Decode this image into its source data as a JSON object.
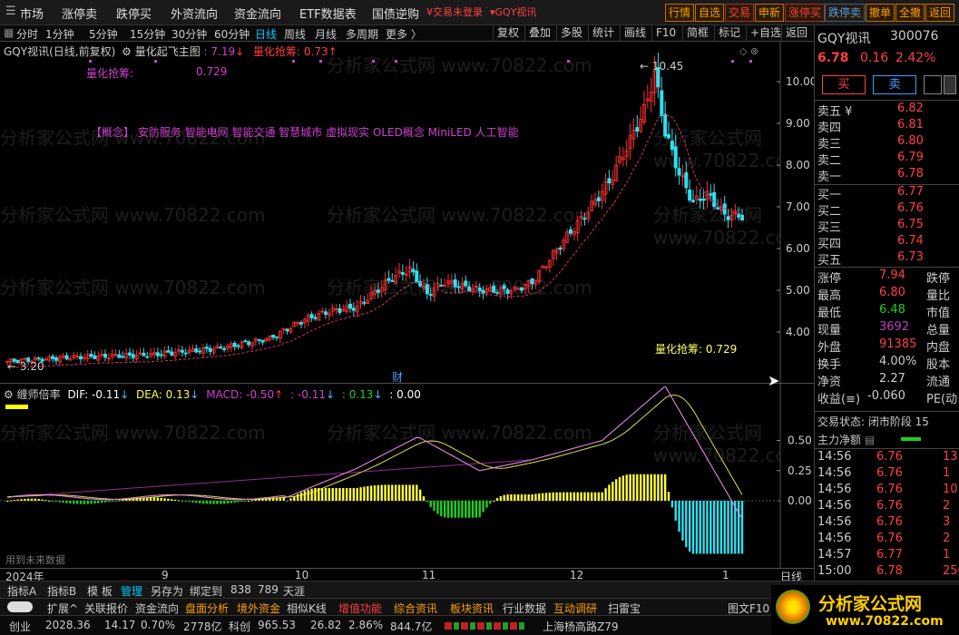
{
  "menu": [
    "市场",
    "涨停卖",
    "跌停买",
    "外资流向",
    "资金流向",
    "ETF数据表",
    "国债逆购"
  ],
  "promo": "¥交易未登录",
  "stock_link": "GQY视讯",
  "top_buttons": [
    "行情",
    "自选",
    "交易",
    "申新",
    "涨停买",
    "跌停卖",
    "撤单",
    "全撤",
    "返回"
  ],
  "periods": [
    "分时",
    "1分钟",
    "5分钟",
    "15分钟",
    "30分钟",
    "60分钟",
    "日线",
    "周线",
    "月线",
    "多周期",
    "更多 〉"
  ],
  "tools": [
    "复权",
    "叠加",
    "多股",
    "统计",
    "画线",
    "F10",
    "简框",
    "标记",
    "+自选",
    "返回"
  ],
  "main_title": {
    "name": "GQY视讯(日线,前复权)",
    "indicator": "量化起飞主图",
    "val1": ": 7.19",
    "label2": "量化抢筹:",
    "val2": "0.73"
  },
  "chip_label": "量化抢筹:",
  "chip_value": "0.729",
  "concept": "【概念】 安防服务 智能电网 智能交通 智慧城市 虚拟现实 OLED概念 MiniLED 人工智能",
  "watermark": "分析家公式网 www.70822.com",
  "yaxis": [
    "10.00",
    "9.00",
    "8.00",
    "7.00",
    "6.00",
    "5.00",
    "4.00"
  ],
  "max_label": "10.45",
  "min_label": "3.20",
  "bottom_label": "量化抢筹:  0.729",
  "cai": "财",
  "macd": {
    "name": "缠师倍率",
    "dif": "DIF: -0.11",
    "dea": "DEA: 0.13",
    "macd": "MACD: -0.50",
    "m1": ": -0.11",
    "m2": ": 0.13",
    "m3": ": 0.00"
  },
  "macd_axis": [
    "0.50",
    "0.25",
    "0.00"
  ],
  "future": "用到未来数据",
  "xaxis": [
    "2024年",
    "9",
    "10",
    "11",
    "12",
    "1"
  ],
  "period_tag": "日线",
  "tabs": [
    "指标A",
    "指标B",
    "模 板",
    "管理",
    "另存为",
    "绑定到",
    "838",
    "789",
    "天涯"
  ],
  "func_tabs": [
    "扩展^",
    "关联报价",
    "资金流向",
    "盘面分析",
    "境外资金",
    "相似K线",
    "增值功能",
    "综合资讯",
    "板块资讯",
    "行业数据",
    "互动调研",
    "扫雷宝"
  ],
  "tuwen": "图文F10",
  "status": {
    "cy": "创业",
    "cy_v": "2028.36",
    "cy_c": "14.17",
    "cy_p": "0.70%",
    "cy_a": "2778亿",
    "kc": "科创",
    "kc_v": "965.53",
    "kc_c": "26.82",
    "kc_p": "2.86%",
    "kc_a": "844.7亿",
    "route": "上海杨高路Z79"
  },
  "quote": {
    "name": "GQY视讯",
    "code": "300076",
    "price": "6.78",
    "change": "0.16",
    "pct": "2.42%",
    "buy": "买",
    "sell": "卖"
  },
  "asks": [
    [
      "卖五 ¥",
      "6.82"
    ],
    [
      "卖四",
      "6.81"
    ],
    [
      "卖三",
      "6.80"
    ],
    [
      "卖二",
      "6.79"
    ],
    [
      "卖一",
      "6.78"
    ]
  ],
  "bids": [
    [
      "买一",
      "6.77"
    ],
    [
      "买二",
      "6.76"
    ],
    [
      "买三",
      "6.75"
    ],
    [
      "买四",
      "6.74"
    ],
    [
      "买五",
      "6.73"
    ]
  ],
  "stats": [
    [
      "涨停",
      "7.94",
      "跌停"
    ],
    [
      "最高",
      "6.80",
      "量比"
    ],
    [
      "最低",
      "6.48",
      "市值"
    ],
    [
      "现量",
      "3692",
      "总量"
    ],
    [
      "外盘",
      "91385",
      "内盘"
    ],
    [
      "换手",
      "4.00%",
      "股本"
    ],
    [
      "净资",
      "2.27",
      "流通"
    ],
    [
      "收益(≡)",
      "-0.060",
      "PE(动"
    ]
  ],
  "trade_state": "交易状态: 闭市阶段 15",
  "netflow": "主力净额",
  "ticks": [
    [
      "14:56",
      "6.76",
      "13"
    ],
    [
      "14:56",
      "6.76",
      "1"
    ],
    [
      "14:56",
      "6.76",
      "10"
    ],
    [
      "14:56",
      "6.76",
      "2"
    ],
    [
      "14:56",
      "6.76",
      "3"
    ],
    [
      "14:56",
      "6.76",
      "2"
    ],
    [
      "14:57",
      "6.77",
      "1"
    ],
    [
      "15:00",
      "6.78",
      "250"
    ]
  ],
  "logo": "分析家公式网",
  "logo_url": "www.70822.com",
  "chart_data": {
    "type": "candlestick",
    "ylim": [
      3.0,
      10.6
    ],
    "max": 10.45,
    "min": 3.2,
    "last_close": 6.78
  }
}
